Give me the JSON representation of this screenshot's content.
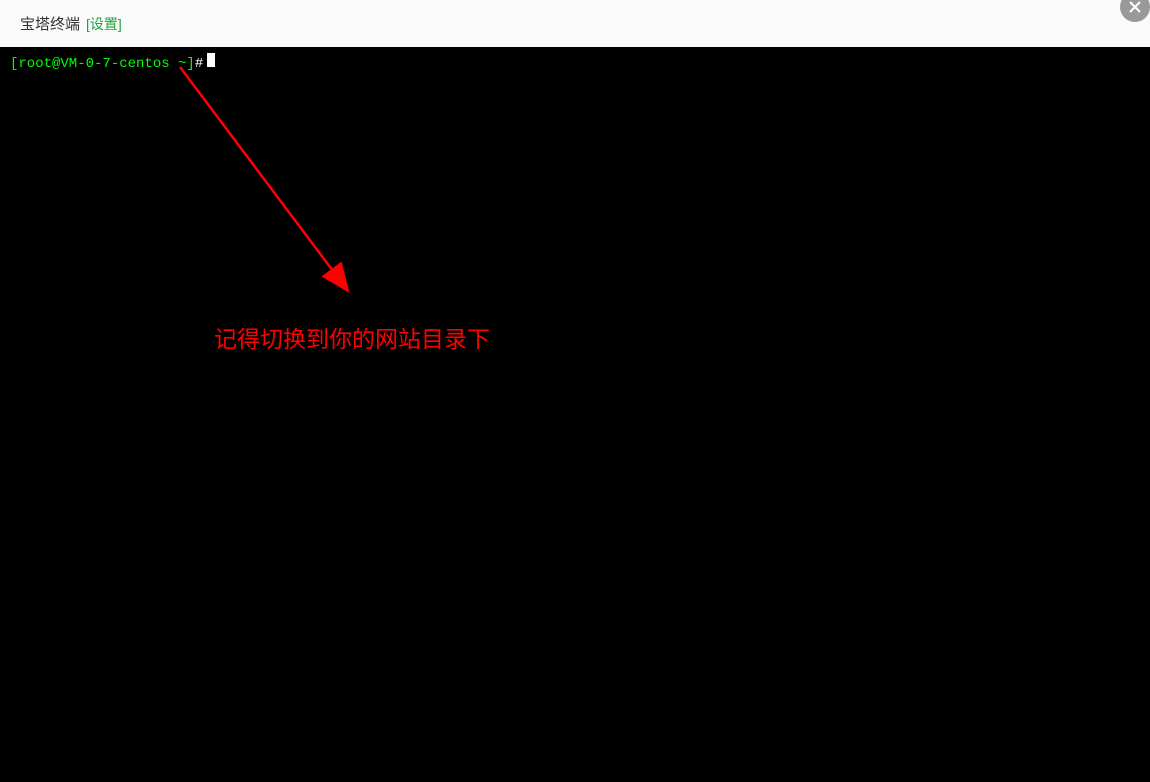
{
  "header": {
    "title": "宝塔终端",
    "settings_link": "设置"
  },
  "terminal": {
    "prompt_user_host": "[root@VM-0-7-centos ~]",
    "prompt_symbol": "#"
  },
  "annotation": {
    "text": "记得切换到你的网站目录下"
  }
}
